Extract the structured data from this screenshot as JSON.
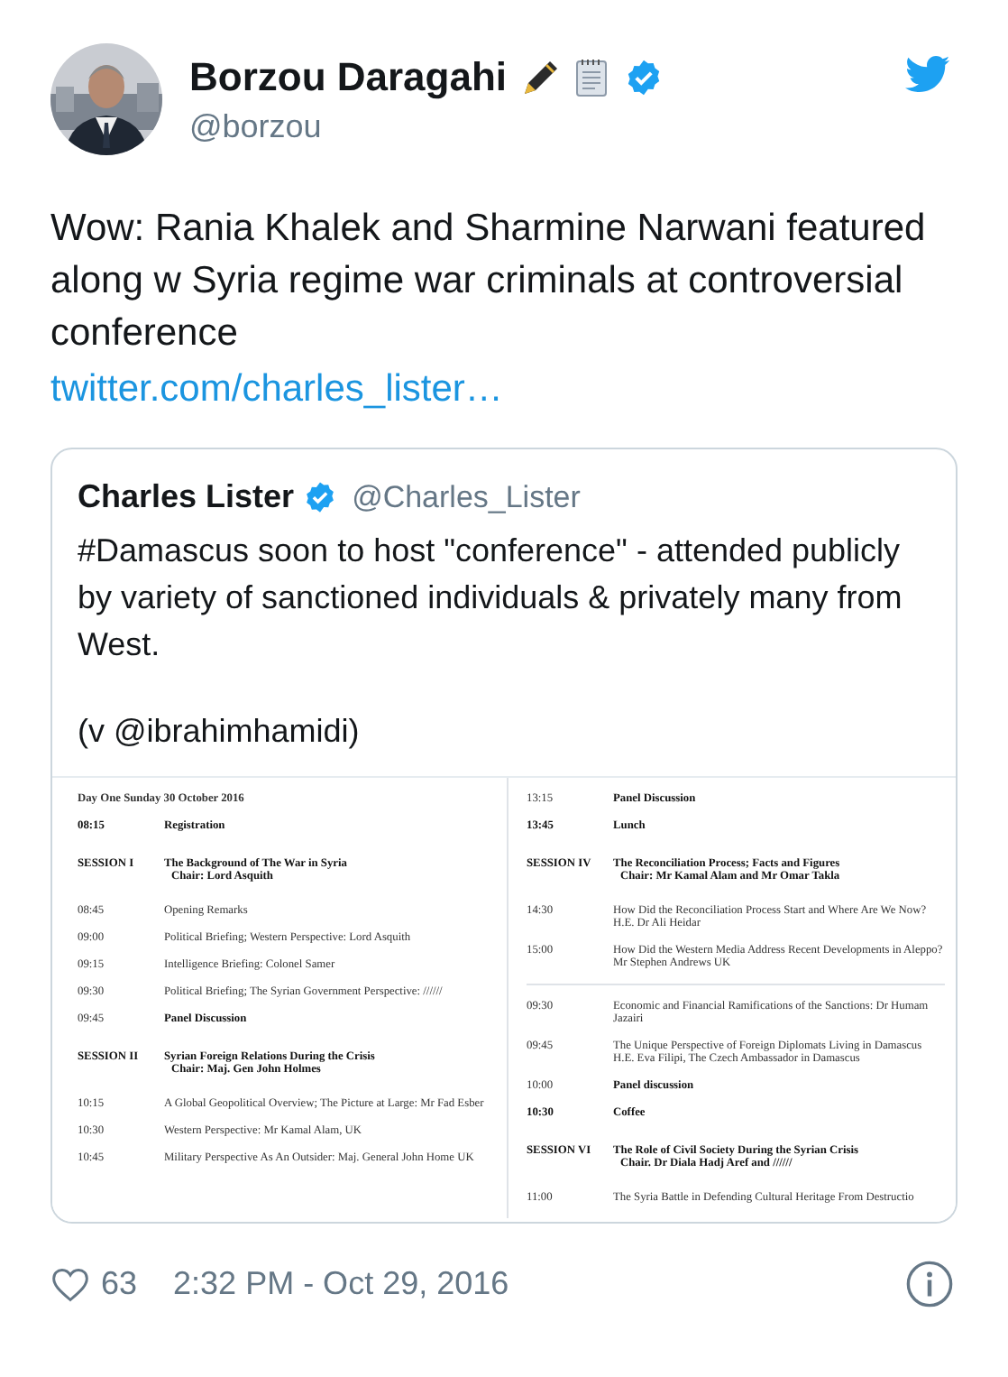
{
  "author": {
    "name": "Borzou Daragahi",
    "handle": "@borzou"
  },
  "text": "Wow: Rania Khalek and Sharmine Narwani featured along w Syria regime war criminals at controversial conference",
  "link": "twitter.com/charles_lister…",
  "quote": {
    "name": "Charles Lister",
    "handle": "@Charles_Lister",
    "paragraphs": [
      "#Damascus soon to host \"conference\" - attended publicly by variety of sanctioned individuals & privately many from West.",
      "(v @ibrahimhamidi)"
    ],
    "document": {
      "pages": [
        {
          "blocks": [
            [
              {
                "kind": "heading",
                "text": "Day One Sunday 30 October 2016"
              },
              {
                "kind": "item",
                "time": "08:15",
                "text": "Registration",
                "bold": true,
                "time_bold": true
              },
              {
                "kind": "session",
                "label": "SESSION I",
                "title": "The Background of The War in Syria",
                "chair": "Chair:  Lord Asquith"
              },
              {
                "kind": "item",
                "time": "08:45",
                "text": "Opening Remarks",
                "bold": false,
                "time_bold": false
              },
              {
                "kind": "item",
                "time": "09:00",
                "text": "Political Briefing; Western Perspective:  Lord Asquith",
                "bold": false,
                "time_bold": false
              },
              {
                "kind": "item",
                "time": "09:15",
                "text": "Intelligence Briefing:  Colonel Samer",
                "bold": false,
                "time_bold": false
              },
              {
                "kind": "item",
                "time": "09:30",
                "text": "Political Briefing; The Syrian Government Perspective: //////",
                "bold": false,
                "time_bold": false
              },
              {
                "kind": "item",
                "time": "09:45",
                "text": "Panel Discussion",
                "bold": true,
                "time_bold": false
              },
              {
                "kind": "session",
                "label": "SESSION II",
                "title": "Syrian Foreign Relations During the Crisis",
                "chair": "Chair:  Maj. Gen John Holmes"
              },
              {
                "kind": "item",
                "time": "10:15",
                "text": "A Global Geopolitical Overview; The Picture at Large: Mr Fad Esber",
                "bold": false,
                "time_bold": false
              },
              {
                "kind": "item",
                "time": "10:30",
                "text": "Western Perspective:  Mr Kamal Alam, UK",
                "bold": false,
                "time_bold": false
              },
              {
                "kind": "item",
                "time": "10:45",
                "text": "Military Perspective As An Outsider:   Maj. General John Home UK",
                "bold": false,
                "time_bold": false
              }
            ]
          ]
        },
        {
          "blocks": [
            [
              {
                "kind": "item",
                "time": "13:15",
                "text": "Panel Discussion",
                "bold": true,
                "time_bold": false
              },
              {
                "kind": "item",
                "time": "13:45",
                "text": "Lunch",
                "bold": true,
                "time_bold": true
              },
              {
                "kind": "session",
                "label": "SESSION IV",
                "title": "The Reconciliation Process; Facts and Figures",
                "chair": "Chair:  Mr Kamal Alam and Mr Omar Takla"
              },
              {
                "kind": "item",
                "time": "14:30",
                "text": "How Did the Reconciliation Process Start and Where Are We Now?  H.E. Dr Ali Heidar",
                "bold": false,
                "time_bold": false
              },
              {
                "kind": "item",
                "time": "15:00",
                "text": "How Did the Western Media Address Recent Developments in Aleppo?  Mr Stephen Andrews UK",
                "bold": false,
                "time_bold": false
              }
            ],
            [
              {
                "kind": "item",
                "time": "09:30",
                "text": "Economic and Financial Ramifications of the Sanctions: Dr Humam Jazairi",
                "bold": false,
                "time_bold": false
              },
              {
                "kind": "item",
                "time": "09:45",
                "text": "The Unique Perspective of Foreign Diplomats Living in Damascus H.E. Eva Filipi, The Czech Ambassador in Damascus",
                "bold": false,
                "time_bold": false
              },
              {
                "kind": "item",
                "time": "10:00",
                "text": "Panel discussion",
                "bold": true,
                "time_bold": false
              },
              {
                "kind": "item",
                "time": "10:30",
                "text": "Coffee",
                "bold": true,
                "time_bold": true
              },
              {
                "kind": "session",
                "label": "SESSION VI",
                "title": "The Role of Civil Society During the Syrian Crisis",
                "chair": "Chair.  Dr Diala Hadj Aref and //////"
              },
              {
                "kind": "item",
                "time": "11:00",
                "text": "The Syria Battle in Defending Cultural Heritage From Destructio",
                "bold": false,
                "time_bold": false
              }
            ]
          ]
        }
      ]
    }
  },
  "likes": "63",
  "time": "2:32 PM - Oct 29, 2016"
}
